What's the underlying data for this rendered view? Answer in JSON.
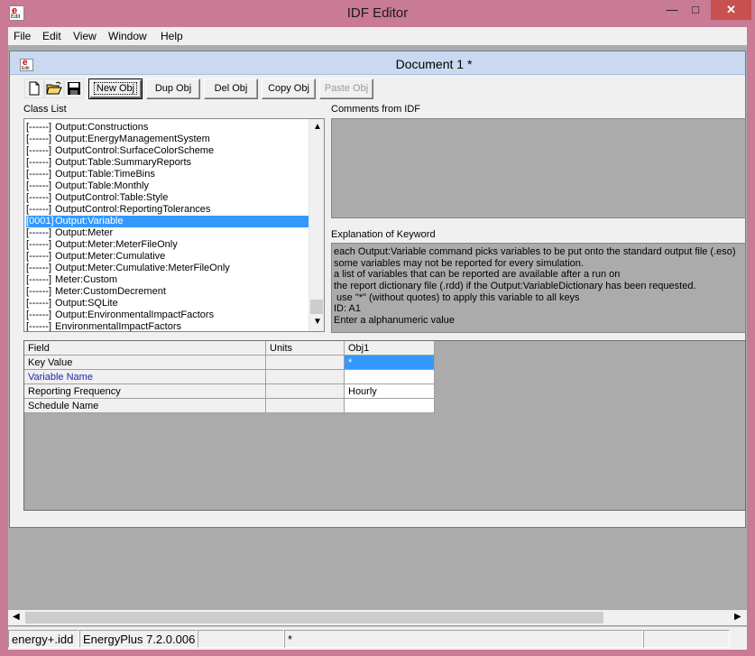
{
  "app": {
    "title": "IDF Editor",
    "icon_text": "Edit"
  },
  "window_controls": {
    "minimize": "—",
    "maximize": "□",
    "close": "✕"
  },
  "menu": [
    "File",
    "Edit",
    "View",
    "Window",
    "Help"
  ],
  "document": {
    "title": "Document 1 *"
  },
  "toolbar": {
    "icons": [
      "new-file-icon",
      "open-folder-icon",
      "save-disk-icon"
    ],
    "buttons": [
      {
        "label": "New Obj",
        "state": "default"
      },
      {
        "label": "Dup Obj",
        "state": "normal"
      },
      {
        "label": "Del Obj",
        "state": "normal"
      },
      {
        "label": "Copy Obj",
        "state": "normal"
      },
      {
        "label": "Paste Obj",
        "state": "disabled"
      }
    ]
  },
  "class_list": {
    "label": "Class List",
    "items": [
      {
        "count": "[------]",
        "name": "Output:Constructions"
      },
      {
        "count": "[------]",
        "name": "Output:EnergyManagementSystem"
      },
      {
        "count": "[------]",
        "name": "OutputControl:SurfaceColorScheme"
      },
      {
        "count": "[------]",
        "name": "Output:Table:SummaryReports"
      },
      {
        "count": "[------]",
        "name": "Output:Table:TimeBins"
      },
      {
        "count": "[------]",
        "name": "Output:Table:Monthly"
      },
      {
        "count": "[------]",
        "name": "OutputControl:Table:Style"
      },
      {
        "count": "[------]",
        "name": "OutputControl:ReportingTolerances"
      },
      {
        "count": "[0001]",
        "name": "Output:Variable",
        "selected": true
      },
      {
        "count": "[------]",
        "name": "Output:Meter"
      },
      {
        "count": "[------]",
        "name": "Output:Meter:MeterFileOnly"
      },
      {
        "count": "[------]",
        "name": "Output:Meter:Cumulative"
      },
      {
        "count": "[------]",
        "name": "Output:Meter:Cumulative:MeterFileOnly"
      },
      {
        "count": "[------]",
        "name": "Meter:Custom"
      },
      {
        "count": "[------]",
        "name": "Meter:CustomDecrement"
      },
      {
        "count": "[------]",
        "name": "Output:SQLite"
      },
      {
        "count": "[------]",
        "name": "Output:EnvironmentalImpactFactors"
      },
      {
        "count": "[------]",
        "name": "EnvironmentalImpactFactors"
      }
    ]
  },
  "comments": {
    "label": "Comments from IDF"
  },
  "explanation": {
    "label": "Explanation of Keyword",
    "lines": [
      "each Output:Variable command picks variables to be put onto the standard output file (.eso)",
      "some variables may not be reported for every simulation.",
      "a list of variables that can be reported are available after a run on",
      "the report dictionary file (.rdd) if the Output:VariableDictionary has been requested.",
      " use \"*\" (without quotes) to apply this variable to all keys",
      "ID: A1",
      "Enter a alphanumeric value"
    ]
  },
  "grid": {
    "headers": {
      "field": "Field",
      "units": "Units",
      "obj": "Obj1"
    },
    "rows": [
      {
        "field": "Key Value",
        "units": "",
        "value": "*",
        "selected": true
      },
      {
        "field": "Variable Name",
        "units": "",
        "value": "",
        "highlight": true
      },
      {
        "field": "Reporting Frequency",
        "units": "",
        "value": "Hourly"
      },
      {
        "field": "Schedule Name",
        "units": "",
        "value": ""
      }
    ]
  },
  "status": {
    "idd": "energy+.idd",
    "version": "EnergyPlus 7.2.0.006",
    "p3": "",
    "p4": "*"
  },
  "colors": {
    "selection": "#3399ff",
    "window_frame": "#c97a95",
    "mdi_background": "#ababab",
    "field_highlight": "#1a2ea8"
  }
}
